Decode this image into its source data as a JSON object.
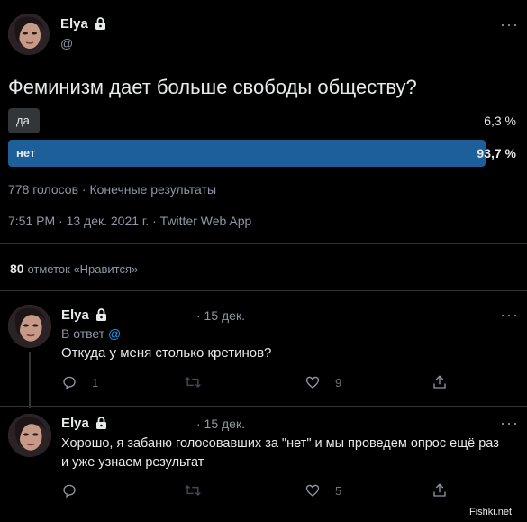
{
  "main_tweet": {
    "author_name": "Elya",
    "author_handle": "@",
    "text": "Феминизм дает больше свободы обществу?",
    "poll": {
      "options": [
        {
          "label": "да",
          "percent": "6,3 %",
          "fraction": 0.063
        },
        {
          "label": "нет",
          "percent": "93,7 %",
          "fraction": 0.937
        }
      ],
      "summary": "778 голосов · Конечные результаты"
    },
    "meta": "7:51 PM · 13 дек. 2021 г. · Twitter Web App",
    "likes_count": "80",
    "likes_label": "отметок «Нравится»",
    "more": "···"
  },
  "replies": [
    {
      "author_name": "Elya",
      "date": "· 15 дек.",
      "reply_prefix": "В ответ",
      "reply_to": "@",
      "text_line1": "Откуда у меня столько кретинов?",
      "text_line2": "",
      "replies_count": "1",
      "likes_count": "9",
      "more": "···"
    },
    {
      "author_name": "Elya",
      "date": "· 15 дек.",
      "text_line1": "Хорошо, я забаню голосовавших за \"нет\" и мы проведем опрос ещё раз",
      "text_line2": "и уже узнаем результат",
      "likes_count": "5",
      "more": "···"
    }
  ],
  "watermark": "Fishki.net",
  "colors": {
    "background": "#000000",
    "poll_winner": "#1d5f99",
    "poll_loser": "#333639",
    "link": "#1d9bf0"
  }
}
